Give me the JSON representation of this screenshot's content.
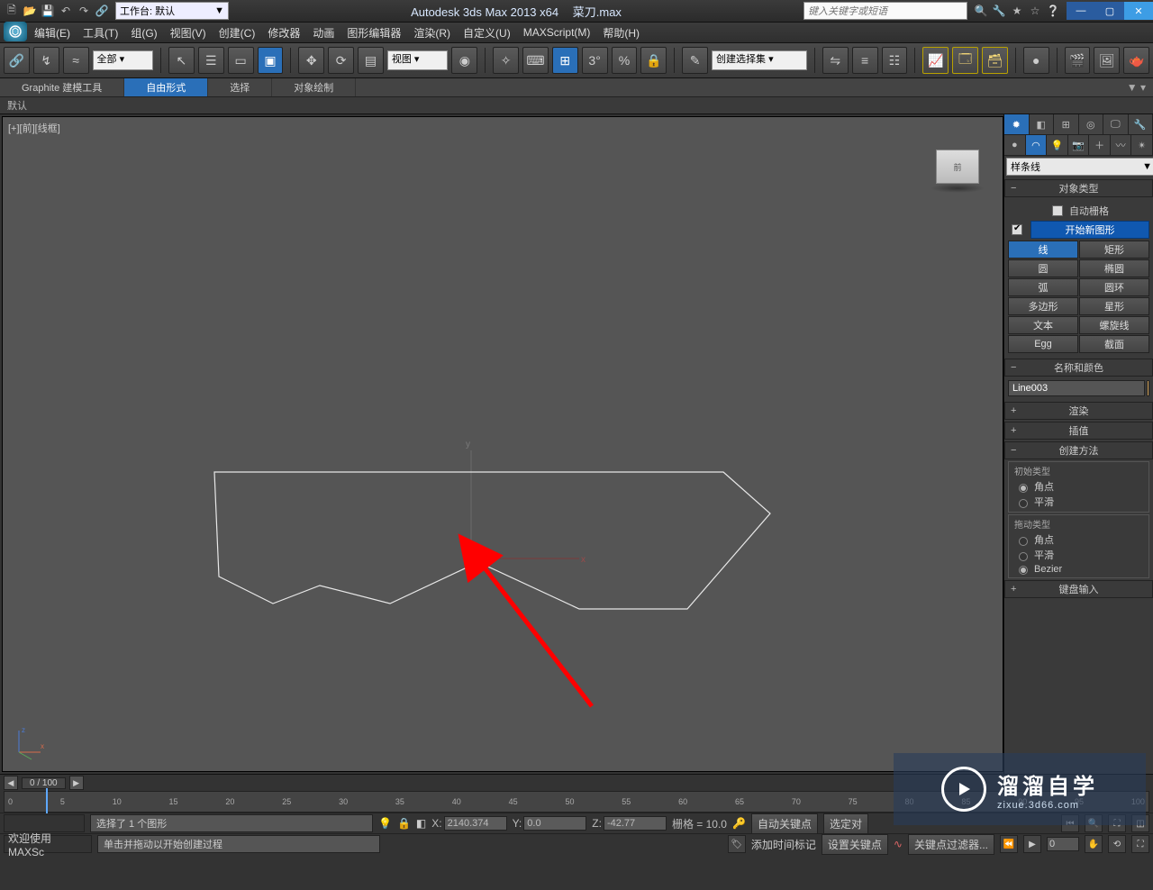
{
  "titlebar": {
    "workspace": "工作台: 默认",
    "title_app": "Autodesk 3ds Max  2013 x64",
    "title_file": "菜刀.max",
    "search_placeholder": "键入关键字或短语"
  },
  "menu": {
    "items": [
      "编辑(E)",
      "工具(T)",
      "组(G)",
      "视图(V)",
      "创建(C)",
      "修改器",
      "动画",
      "图形编辑器",
      "渲染(R)",
      "自定义(U)",
      "MAXScript(M)",
      "帮助(H)"
    ]
  },
  "toolbar": {
    "filter": "全部",
    "view_dropdown": "视图",
    "set_list_placeholder": "创建选择集"
  },
  "ribbon": {
    "tabs": [
      "Graphite 建模工具",
      "自由形式",
      "选择",
      "对象绘制"
    ],
    "active": 1,
    "default_label": "默认"
  },
  "viewport": {
    "label": "[+][前][线框]",
    "viewcube_face": "前"
  },
  "cmd": {
    "category": "样条线",
    "rollout_obj_type": "对象类型",
    "auto_grid": "自动栅格",
    "start_new_shape": "开始新图形",
    "shapes": [
      "线",
      "矩形",
      "圆",
      "椭圆",
      "弧",
      "圆环",
      "多边形",
      "星形",
      "文本",
      "螺旋线",
      "Egg",
      "截面"
    ],
    "shape_active": 0,
    "rollout_name_color": "名称和颜色",
    "object_name": "Line003",
    "rollout_render": "渲染",
    "rollout_interp": "插值",
    "rollout_create_method": "创建方法",
    "initial_type": "初始类型",
    "initial_options": [
      "角点",
      "平滑"
    ],
    "initial_selected": 0,
    "drag_type": "拖动类型",
    "drag_options": [
      "角点",
      "平滑",
      "Bezier"
    ],
    "drag_selected": 2,
    "rollout_keyboard": "键盘输入"
  },
  "timeline": {
    "current": "0 / 100",
    "ticks": [
      "0",
      "5",
      "10",
      "15",
      "20",
      "25",
      "30",
      "35",
      "40",
      "45",
      "50",
      "55",
      "60",
      "65",
      "70",
      "75",
      "80",
      "85",
      "90",
      "95",
      "100"
    ]
  },
  "status": {
    "prompt1": "选择了 1 个图形",
    "prompt2": "单击并拖动以开始创建过程",
    "x": "2140.374",
    "y": "0.0",
    "z": "-42.77",
    "grid": "栅格 = 10.0",
    "auto_key": "自动关键点",
    "set_key": "设置关键点",
    "filter_label": "关键点过滤器...",
    "select_label": "选定对",
    "time_tags": "添加时间标记"
  },
  "greeting": "欢迎使用  MAXSc",
  "watermark": {
    "brand": "溜溜自学",
    "url": "zixue.3d66.com"
  }
}
